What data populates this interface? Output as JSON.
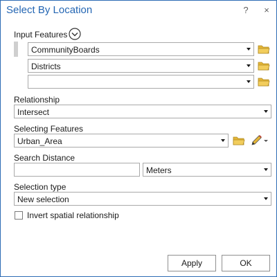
{
  "window": {
    "title": "Select By Location",
    "help_glyph": "?",
    "close_glyph": "×"
  },
  "input_features": {
    "label": "Input Features",
    "rows": [
      {
        "value": "CommunityBoards"
      },
      {
        "value": "Districts"
      },
      {
        "value": ""
      }
    ]
  },
  "relationship": {
    "label": "Relationship",
    "value": "Intersect"
  },
  "selecting_features": {
    "label": "Selecting Features",
    "value": "Urban_Area"
  },
  "search_distance": {
    "label": "Search Distance",
    "value": "",
    "unit": "Meters"
  },
  "selection_type": {
    "label": "Selection type",
    "value": "New selection"
  },
  "invert": {
    "label": "Invert spatial relationship",
    "checked": false
  },
  "footer": {
    "apply_label": "Apply",
    "ok_label": "OK"
  },
  "colors": {
    "accent": "#2466b3",
    "folder": "#e4b537",
    "border": "#a9a9a9"
  },
  "icons": [
    "chevron-down-circle-icon",
    "folder-icon",
    "pencil-icon",
    "dropdown-arrow-icon",
    "help-icon",
    "close-icon"
  ]
}
